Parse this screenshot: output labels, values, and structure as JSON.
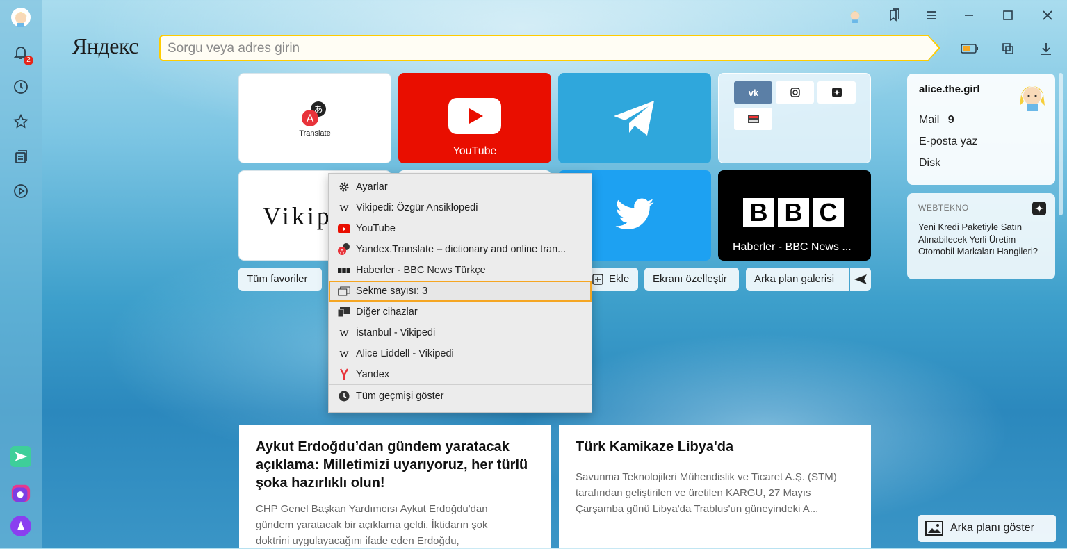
{
  "browser": {
    "brand": "Яндекс",
    "omnibox_placeholder": "Sorgu veya adres girin"
  },
  "sidebar": {
    "notification_count": "2"
  },
  "tiles": {
    "translate_caption": "Translate",
    "youtube_label": "YouTube",
    "wiki_text": "Vikip",
    "bbc_logo": [
      "B",
      "B",
      "C"
    ],
    "bbc_label": "Haberler - BBC News ..."
  },
  "toolbar": {
    "all_bookmarks": "Tüm favoriler",
    "add": "Ekle",
    "customize": "Ekranı özelleştir",
    "bg_gallery": "Arka plan galerisi"
  },
  "history_menu": {
    "items": [
      {
        "icon": "gear-icon",
        "label": "Ayarlar"
      },
      {
        "icon": "wikipedia-icon",
        "label": "Vikipedi: Özgür Ansiklopedi"
      },
      {
        "icon": "youtube-icon",
        "label": "YouTube"
      },
      {
        "icon": "translate-icon",
        "label": "Yandex.Translate – dictionary and online tran..."
      },
      {
        "icon": "bbc-icon",
        "label": "Haberler - BBC News Türkçe"
      },
      {
        "icon": "tabs-icon",
        "label": "Sekme sayısı: 3"
      },
      {
        "icon": "devices-icon",
        "label": "Diğer cihazlar"
      },
      {
        "icon": "wikipedia-icon",
        "label": "İstanbul - Vikipedi"
      },
      {
        "icon": "wikipedia-icon",
        "label": "Alice Liddell - Vikipedi"
      },
      {
        "icon": "yandex-icon",
        "label": "Yandex"
      }
    ],
    "show_all": "Tüm geçmişi göster"
  },
  "profile": {
    "username": "alice.the.girl",
    "mail_label": "Mail",
    "mail_count": "9",
    "compose": "E-posta yaz",
    "disk": "Disk"
  },
  "zen_card": {
    "source": "WEBTEKNO",
    "title": "Yeni Kredi Paketiyle Satın Alınabilecek Yerli Üretim Otomobil Markaları Hangileri?"
  },
  "news": [
    {
      "title": "Aykut Erdoğdu’dan gündem yaratacak açıklama: Milletimizi uyarıyoruz, her türlü şoka hazırlıklı olun!",
      "body": "CHP Genel Başkan Yardımcısı Aykut Erdoğdu'dan gündem yaratacak bir açıklama geldi. İktidarın şok doktrini uygulayacağını ifade eden Erdoğdu,"
    },
    {
      "title": "Türk Kamikaze Libya'da",
      "body": "Savunma Teknolojileri Mühendislik ve Ticaret A.Ş. (STM) tarafından geliştirilen ve üretilen KARGU, 27 Mayıs Çarşamba günü Libya'da Trablus'un güneyindeki A..."
    }
  ],
  "show_background": "Arka planı göster",
  "colors": {
    "accent": "#ffcc00",
    "youtube_red": "#e90e00",
    "telegram_blue": "#2fa7dc",
    "twitter_blue": "#1da1f2",
    "highlight_outline": "#f5a623",
    "badge_red": "#e5261a"
  }
}
